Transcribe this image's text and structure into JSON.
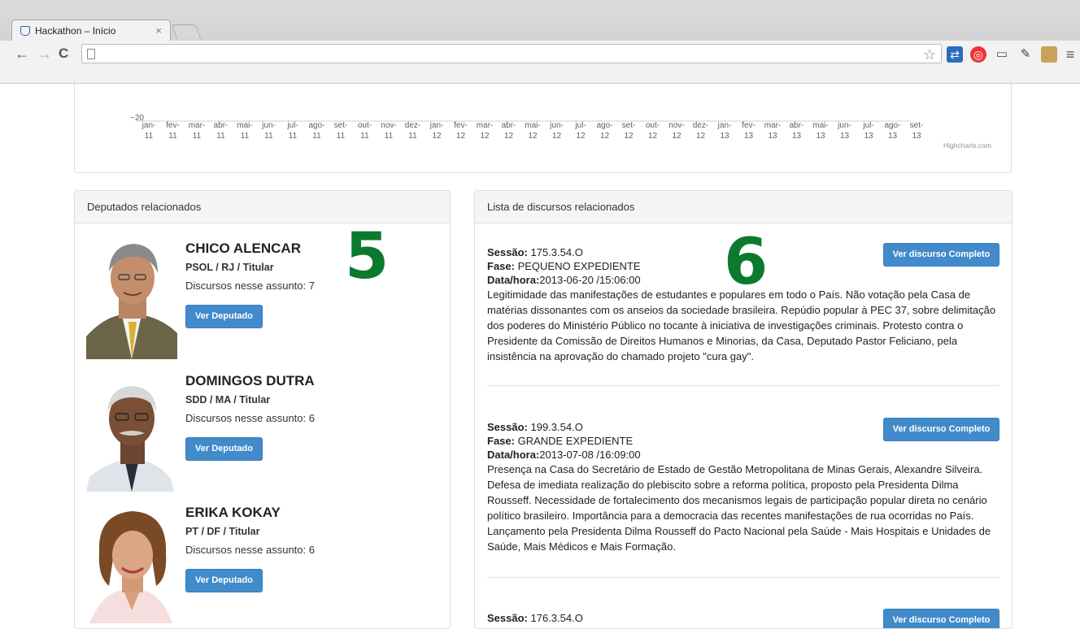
{
  "browser": {
    "tab_title": "Hackathon – Início",
    "tab_close": "×",
    "back": "←",
    "forward": "→",
    "reload": "C",
    "star": "☆",
    "menu": "≡"
  },
  "chart": {
    "y_tick": "−20",
    "credit": "Highcharts.com",
    "x_months": [
      "jan-",
      "fev-",
      "mar-",
      "abr-",
      "mai-",
      "jun-",
      "jul-",
      "ago-",
      "set-",
      "out-",
      "nov-",
      "dez-",
      "jan-",
      "fev-",
      "mar-",
      "abr-",
      "mai-",
      "jun-",
      "jul-",
      "ago-",
      "set-",
      "out-",
      "nov-",
      "dez-",
      "jan-",
      "fev-",
      "mar-",
      "abr-",
      "mai-",
      "jun-",
      "jul-",
      "ago-",
      "set-"
    ],
    "x_years": [
      "11",
      "11",
      "11",
      "11",
      "11",
      "11",
      "11",
      "11",
      "11",
      "11",
      "11",
      "11",
      "12",
      "12",
      "12",
      "12",
      "12",
      "12",
      "12",
      "12",
      "12",
      "12",
      "12",
      "12",
      "13",
      "13",
      "13",
      "13",
      "13",
      "13",
      "13",
      "13",
      "13"
    ]
  },
  "deputies_panel": {
    "heading": "Deputados relacionados",
    "annotation": "5",
    "items": [
      {
        "name": "CHICO ALENCAR",
        "party": "PSOL / RJ / Titular",
        "count": "Discursos nesse assunto: 7",
        "button": "Ver Deputado"
      },
      {
        "name": "DOMINGOS DUTRA",
        "party": "SDD / MA / Titular",
        "count": "Discursos nesse assunto: 6",
        "button": "Ver Deputado"
      },
      {
        "name": "ERIKA KOKAY",
        "party": "PT / DF / Titular",
        "count": "Discursos nesse assunto: 6",
        "button": "Ver Deputado"
      }
    ]
  },
  "speeches_panel": {
    "heading": "Lista de discursos relacionados",
    "annotation": "6",
    "labels": {
      "session": "Sessão:",
      "phase": "Fase:",
      "datetime": "Data/hora:"
    },
    "button": "Ver discurso Completo",
    "items": [
      {
        "session": " 175.3.54.O",
        "phase": " PEQUENO EXPEDIENTE",
        "datetime": "2013-06-20 /15:06:00",
        "text": "Legitimidade das manifestações de estudantes e populares em todo o País. Não votação pela Casa de matérias dissonantes com os anseios da sociedade brasileira. Repúdio popular à PEC 37, sobre delimitação dos poderes do Ministério Público no tocante à iniciativa de investigações criminais. Protesto contra o Presidente da Comissão de Direitos Humanos e Minorias, da Casa, Deputado Pastor Feliciano, pela insistência na aprovação do chamado projeto \"cura gay\"."
      },
      {
        "session": " 199.3.54.O",
        "phase": " GRANDE EXPEDIENTE",
        "datetime": "2013-07-08 /16:09:00",
        "text": "Presença na Casa do Secretário de Estado de Gestão Metropolitana de Minas Gerais, Alexandre Silveira. Defesa de imediata realização do plebiscito sobre a reforma política, proposto pela Presidenta Dilma Rousseff. Necessidade de fortalecimento dos mecanismos legais de participação popular direta no cenário político brasileiro. Importância para a democracia das recentes manifestações de rua ocorridas no País. Lançamento pela Presidenta Dilma Rousseff do Pacto Nacional pela Saúde - Mais Hospitais e Unidades de Saúde, Mais Médicos e Mais Formação."
      },
      {
        "session": " 176.3.54.O"
      }
    ]
  }
}
